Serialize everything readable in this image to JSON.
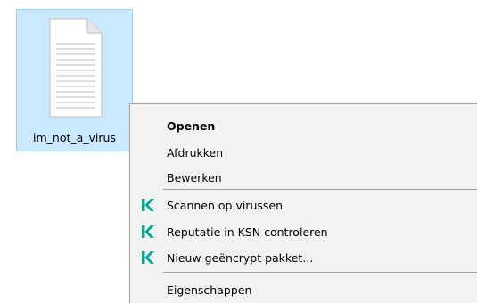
{
  "file": {
    "name": "im_not_a_virus",
    "icon": "text-document-icon",
    "selected": true
  },
  "context_menu": {
    "items": [
      {
        "label": "Openen",
        "bold": true,
        "icon": null
      },
      {
        "label": "Afdrukken",
        "bold": false,
        "icon": null
      },
      {
        "label": "Bewerken",
        "bold": false,
        "icon": null
      },
      {
        "label": "Scannen op virussen",
        "bold": false,
        "icon": "kaspersky-k-icon"
      },
      {
        "label": "Reputatie in KSN controleren",
        "bold": false,
        "icon": "kaspersky-k-icon"
      },
      {
        "label": "Nieuw geëncrypt pakket...",
        "bold": false,
        "icon": "kaspersky-k-icon"
      },
      {
        "label": "Eigenschappen",
        "bold": false,
        "icon": null
      }
    ]
  },
  "colors": {
    "selection_fill": "#cce8ff",
    "selection_border": "#99d1ff",
    "menu_background": "#f2f2f2",
    "kaspersky_green": "#00a88e"
  }
}
